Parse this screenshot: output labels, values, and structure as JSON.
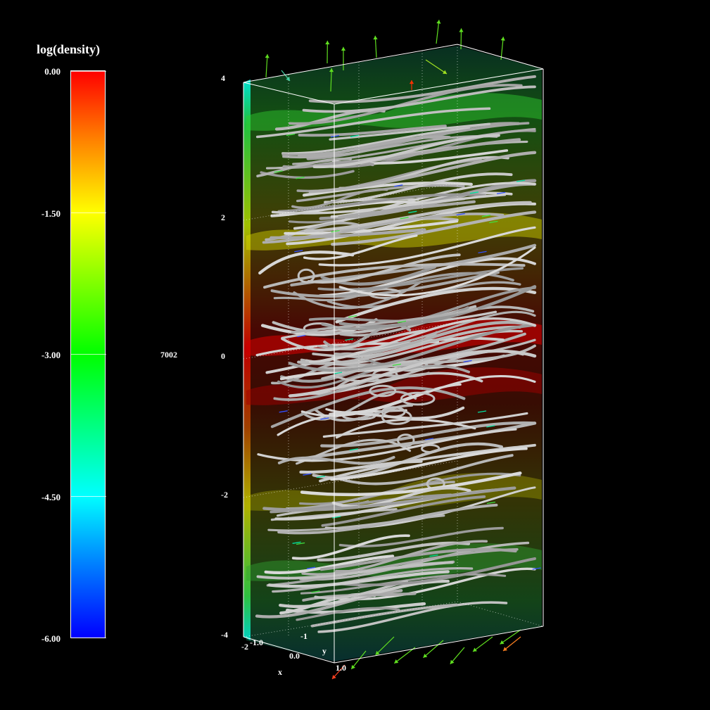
{
  "colorbar": {
    "title": "log(density)",
    "ticks": [
      "0.00",
      "-1.50",
      "-3.00",
      "-4.50",
      "-6.00"
    ]
  },
  "frame_number": "7002",
  "z_axis": {
    "ticks": [
      "4",
      "2",
      "0",
      "-2",
      "-4"
    ]
  },
  "x_axis": {
    "label": "x",
    "ticks": [
      "-1.0",
      "0.0",
      "1.0"
    ]
  },
  "y_axis": {
    "label": "y",
    "ticks": [
      "-2",
      "-1"
    ]
  },
  "colors": {
    "background": "#000000",
    "streamline": "#b8b8b8",
    "cap_green": "#22b822",
    "mid_yellow": "#c8c800",
    "core_red": "#c00000"
  }
}
